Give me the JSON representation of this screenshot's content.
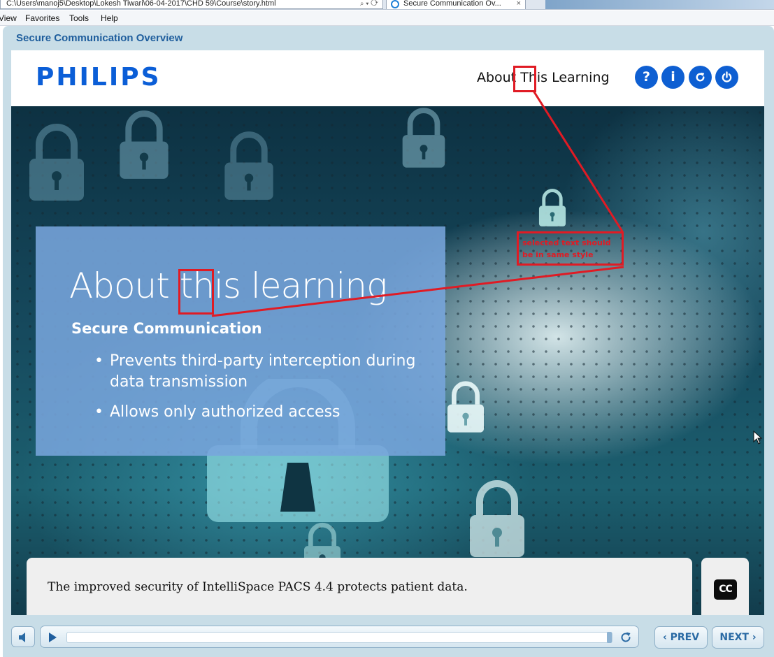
{
  "browser": {
    "address": "C:\\Users\\manoj5\\Desktop\\Lokesh Tiwari\\06-04-2017\\CHD 59\\Course\\story.html",
    "tab_title": "Secure Communication Ov...",
    "tab_close": "×",
    "menu": [
      "View",
      "Favorites",
      "Tools",
      "Help"
    ]
  },
  "player": {
    "title": "Secure Communication Overview"
  },
  "header": {
    "logo": "PHILIPS",
    "about_link": "About This Learning",
    "buttons": [
      {
        "name": "help",
        "glyph": "?"
      },
      {
        "name": "info",
        "glyph": "i"
      },
      {
        "name": "replay",
        "icon": "replay-icon"
      },
      {
        "name": "exit",
        "icon": "power-icon"
      }
    ],
    "accent_color": "#0e5fd2"
  },
  "slide": {
    "title": "About this learning",
    "subtitle": "Secure Communication",
    "bullets": [
      "Prevents third-party interception during data transmission",
      "Allows only authorized access"
    ]
  },
  "annotation": {
    "note": "selected text should be in same style",
    "color": "#e01b24"
  },
  "caption": {
    "text": "The improved security of IntelliSpace PACS 4.4 protects patient data.",
    "cc_label": "CC"
  },
  "controls": {
    "prev_label": "PREV",
    "next_label": "NEXT",
    "progress": 1.0
  }
}
